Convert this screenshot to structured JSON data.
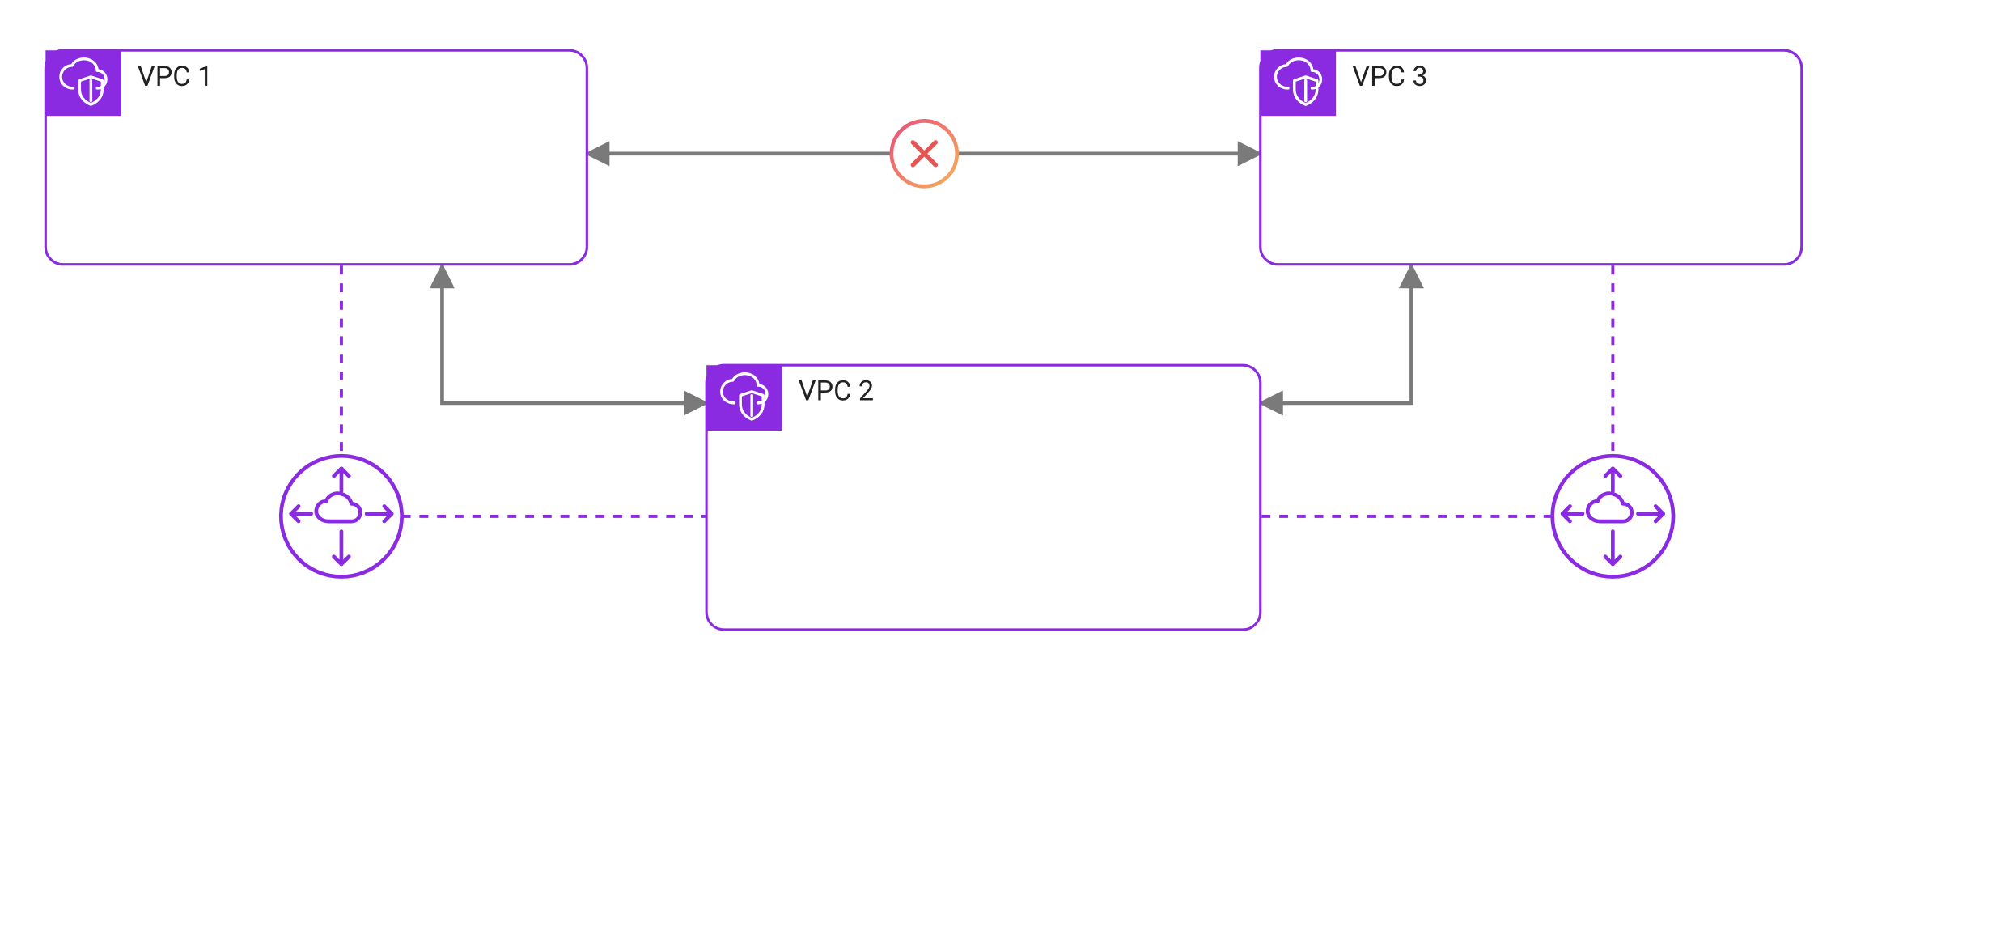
{
  "diagram": {
    "nodes": {
      "vpc1": {
        "label": "VPC 1",
        "type": "vpc"
      },
      "vpc2": {
        "label": "VPC 2",
        "type": "vpc"
      },
      "vpc3": {
        "label": "VPC 3",
        "type": "vpc"
      },
      "gatewayLeft": {
        "type": "internet-gateway"
      },
      "gatewayRight": {
        "type": "internet-gateway"
      }
    },
    "connections": [
      {
        "from": "vpc1",
        "to": "vpc3",
        "style": "solid",
        "bidirectional": true,
        "blocked": true
      },
      {
        "from": "vpc1",
        "to": "vpc2",
        "style": "solid",
        "bidirectional": true,
        "blocked": false
      },
      {
        "from": "vpc3",
        "to": "vpc2",
        "style": "solid",
        "bidirectional": true,
        "blocked": false
      },
      {
        "from": "vpc1",
        "to": "gatewayLeft",
        "style": "dashed"
      },
      {
        "from": "vpc2",
        "to": "gatewayLeft",
        "style": "dashed"
      },
      {
        "from": "vpc3",
        "to": "gatewayRight",
        "style": "dashed"
      },
      {
        "from": "vpc2",
        "to": "gatewayRight",
        "style": "dashed"
      }
    ],
    "colors": {
      "accent": "#8a2be2",
      "connector": "#7a7a7a",
      "blocked": "#e35656"
    }
  }
}
